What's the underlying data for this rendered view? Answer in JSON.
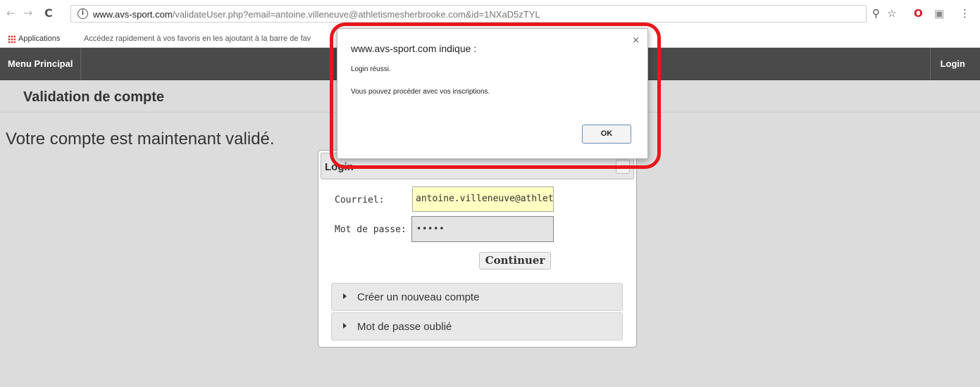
{
  "browser": {
    "back_glyph": "←",
    "forward_glyph": "→",
    "reload_glyph": "C",
    "info_glyph": "i",
    "url_domain": "www.avs-sport.com",
    "url_path": "/validateUser.php?email=antoine.villeneuve@athletismesherbrooke.com&id=1NXaD5zTYL",
    "icons": [
      "back-icon",
      "forward-icon",
      "reload-icon",
      "info-icon",
      "key-icon",
      "star-icon",
      "opera-icon",
      "extension-icon",
      "menu-icon"
    ],
    "key_glyph": "⚲",
    "star_glyph": "☆",
    "opera_glyph": "O",
    "ext_glyph": "▣",
    "menu_glyph": "⋮",
    "bookmarks": {
      "apps_label": "Applications",
      "hint": "Accédez rapidement à vos favoris en les ajoutant à la barre de fav"
    }
  },
  "site": {
    "nav_main": "Menu Principal",
    "nav_login": "Login",
    "page_title": "Validation de compte",
    "message": "Votre compte est maintenant validé."
  },
  "login_dialog": {
    "title": "Login",
    "close_glyph": "×",
    "email_label": "Courriel:",
    "email_value": "antoine.villeneuve@athletis",
    "password_label": "Mot de passe:",
    "password_value": "•••••",
    "continue_label": "Continuer",
    "accordion": [
      "Créer un nouveau compte",
      "Mot de passe oublié"
    ]
  },
  "alert": {
    "origin": "www.avs-sport.com indique :",
    "line1": "Login réussi.",
    "line2": "Vous pouvez procéder avec vos inscriptions.",
    "ok_label": "OK",
    "close_glyph": "×"
  },
  "colors": {
    "highlight": "#e8161c",
    "navbar": "#4a4a4a",
    "email_field_bg": "#ffffc2",
    "page_bg": "#dcdcdc"
  }
}
